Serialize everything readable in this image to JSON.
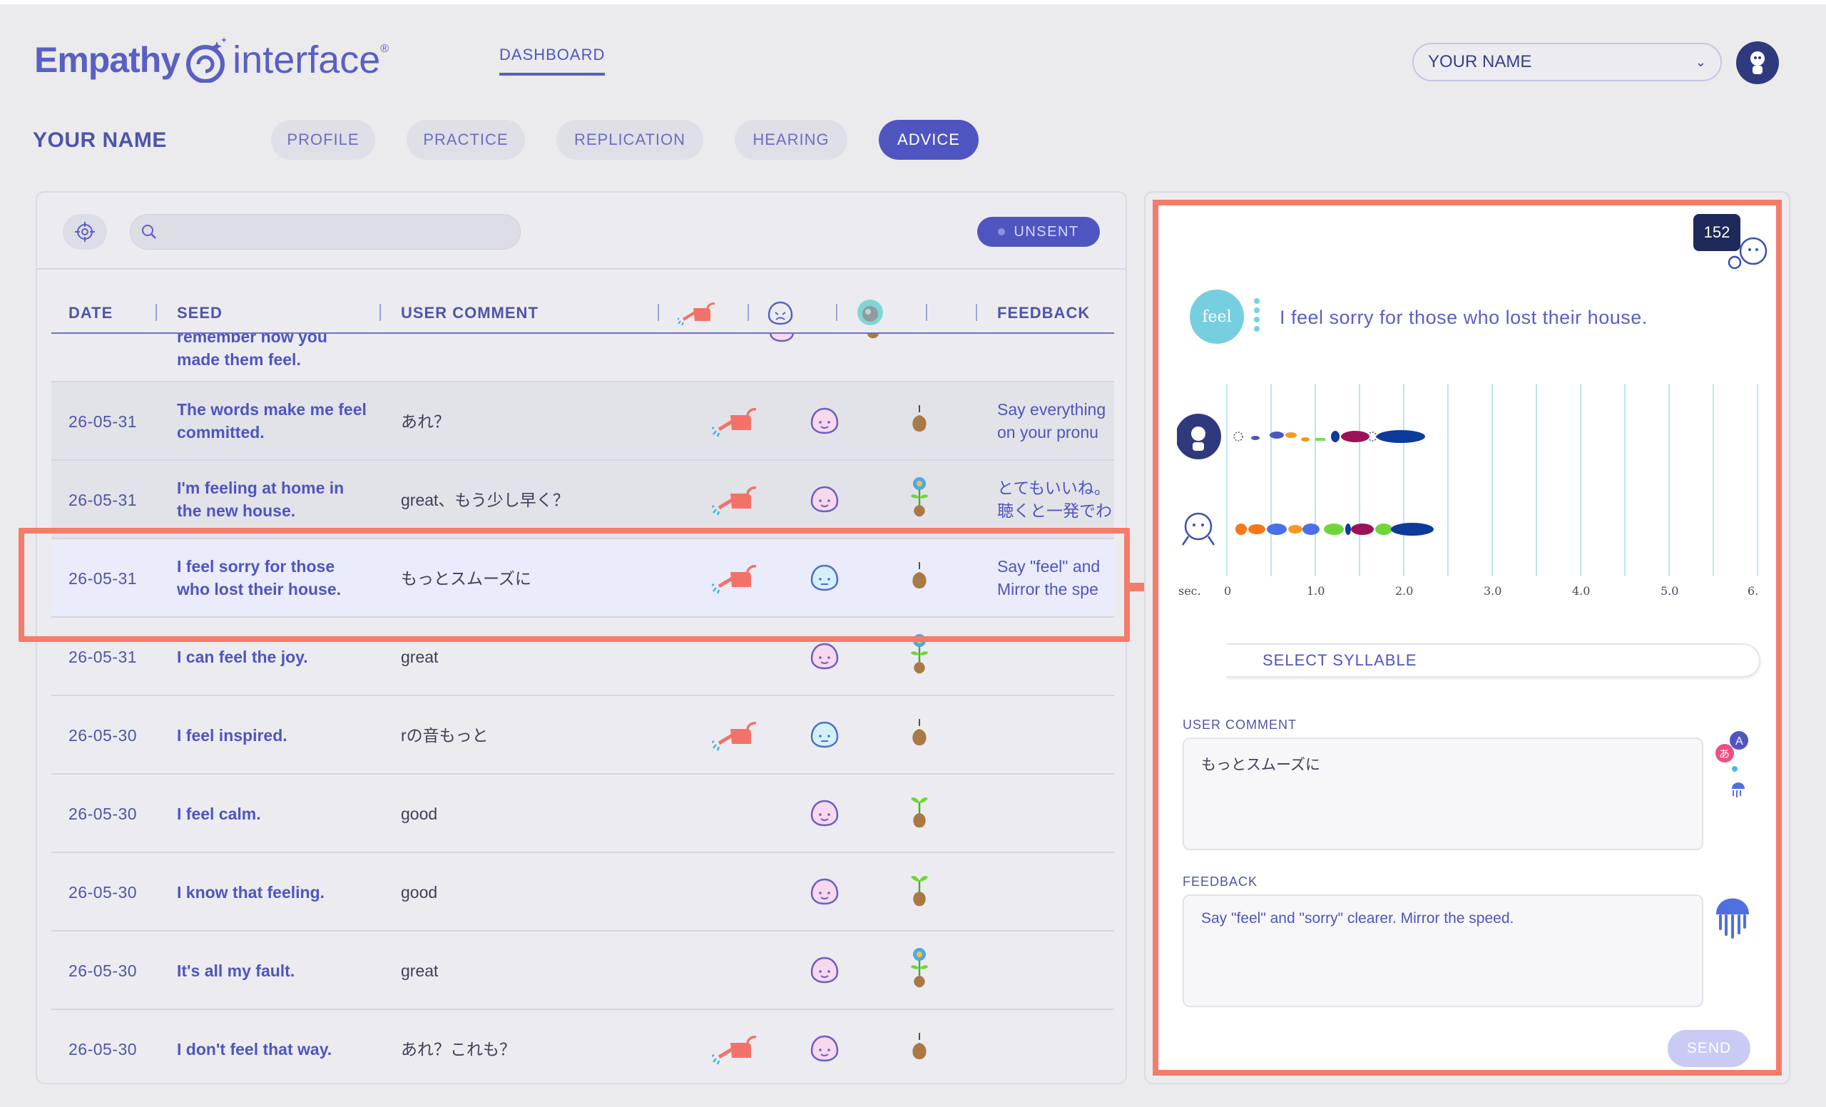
{
  "header": {
    "logo_word1": "Empathy",
    "logo_word2": "interface",
    "logo_reg": "®",
    "dashboard_link": "DASHBOARD",
    "name_select_value": "YOUR NAME",
    "user_name": "YOUR NAME"
  },
  "tabs": [
    {
      "label": "PROFILE",
      "active": false
    },
    {
      "label": "PRACTICE",
      "active": false
    },
    {
      "label": "REPLICATION",
      "active": false
    },
    {
      "label": "HEARING",
      "active": false
    },
    {
      "label": "ADVICE",
      "active": true
    }
  ],
  "toolbar": {
    "search_placeholder": "",
    "unsent_label": "UNSENT"
  },
  "table": {
    "headers": {
      "date": "DATE",
      "seed": "SEED",
      "user_comment": "USER COMMENT",
      "feedback": "FEEDBACK"
    },
    "partial_top_seed": "remember how you made them feel.",
    "rows": [
      {
        "date": "26-05-31",
        "seed": "The words make me feel committed.",
        "comment": "あれ？",
        "water": true,
        "face": "pink-smile",
        "plant": "bulb",
        "feedback": "Say everything on your pronu",
        "style": "shaded"
      },
      {
        "date": "26-05-31",
        "seed": "I'm feeling at home in the new house.",
        "comment": "great、もう少し早く？",
        "water": true,
        "face": "pink-smile",
        "plant": "flower",
        "feedback": "とてもいいね。聴くと一発でわ",
        "style": "shaded"
      },
      {
        "date": "26-05-31",
        "seed": "I feel sorry for those who lost their house.",
        "comment": "もっとスムーズに",
        "water": true,
        "face": "blue-neutral",
        "plant": "bulb",
        "feedback": "Say \"feel\" and Mirror the spe",
        "style": "selected"
      },
      {
        "date": "26-05-31",
        "seed": "I can feel the joy.",
        "comment": "great",
        "water": false,
        "face": "pink-smile",
        "plant": "flower",
        "feedback": "",
        "style": "plain"
      },
      {
        "date": "26-05-30",
        "seed": "I feel inspired.",
        "comment": "rの音もっと",
        "water": true,
        "face": "blue-neutral",
        "plant": "bulb",
        "feedback": "",
        "style": "plain"
      },
      {
        "date": "26-05-30",
        "seed": "I feel calm.",
        "comment": "good",
        "water": false,
        "face": "pink-smile",
        "plant": "sprout",
        "feedback": "",
        "style": "plain"
      },
      {
        "date": "26-05-30",
        "seed": "I know that feeling.",
        "comment": "good",
        "water": false,
        "face": "pink-smile",
        "plant": "sprout",
        "feedback": "",
        "style": "plain"
      },
      {
        "date": "26-05-30",
        "seed": "It's all my fault.",
        "comment": "great",
        "water": false,
        "face": "pink-smile",
        "plant": "flower",
        "feedback": "",
        "style": "plain"
      },
      {
        "date": "26-05-30",
        "seed": "I don't feel that way.",
        "comment": "あれ？これも？",
        "water": true,
        "face": "pink-smile",
        "plant": "bulb",
        "feedback": "",
        "style": "plain"
      }
    ]
  },
  "detail": {
    "counter": "152",
    "word_badge": "feel",
    "sentence": "I feel sorry for those who lost their house.",
    "x_axis_unit": "sec.",
    "x_ticks": [
      "0",
      "1.0",
      "2.0",
      "3.0",
      "4.0",
      "5.0",
      "6."
    ],
    "select_syllable_label": "SELECT SYLLABLE",
    "user_comment_label": "USER COMMENT",
    "user_comment_text": "もっとスムーズに",
    "feedback_label": "FEEDBACK",
    "feedback_text": "Say \"feel\" and \"sorry\" clearer. Mirror the speed.",
    "send_label": "SEND"
  },
  "colors": {
    "accent": "#4f55c0",
    "highlight": "#f47c6b",
    "badge": "#76cfe0"
  }
}
